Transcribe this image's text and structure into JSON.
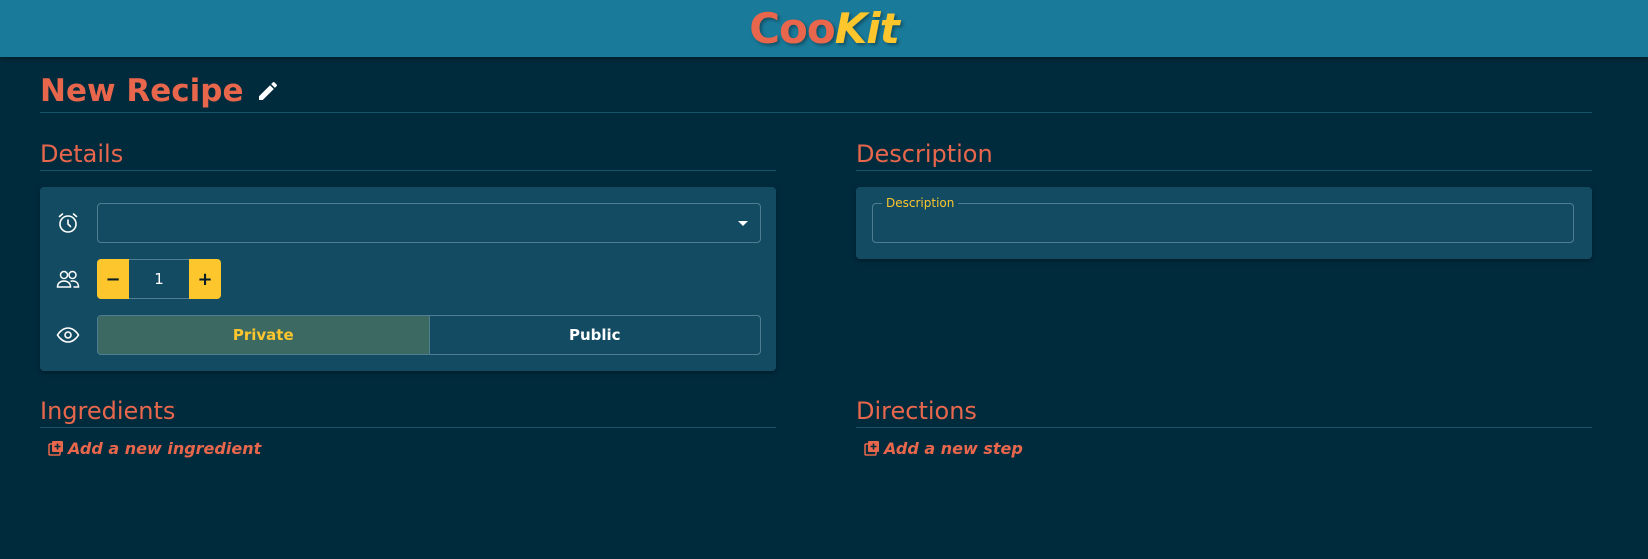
{
  "header": {
    "logo_part1": "Coo",
    "logo_part2": "Kit"
  },
  "page": {
    "title": "New Recipe"
  },
  "details": {
    "title": "Details",
    "time_select_value": "",
    "servings": {
      "minus_label": "−",
      "value": "1",
      "plus_label": "+"
    },
    "visibility": {
      "options": [
        "Private",
        "Public"
      ],
      "selected": "Private"
    }
  },
  "description": {
    "title": "Description",
    "field_label": "Description",
    "value": ""
  },
  "ingredients": {
    "title": "Ingredients",
    "add_label": "Add a new ingredient"
  },
  "directions": {
    "title": "Directions",
    "add_label": "Add a new step"
  },
  "colors": {
    "background": "#002b3d",
    "header": "#1a7a9a",
    "card": "#134b63",
    "accent_orange": "#e8674c",
    "accent_yellow": "#fcc62c",
    "toggle_active": "#3c6a62"
  },
  "icons": {
    "edit": "pencil-icon",
    "time": "alarm-clock-icon",
    "servings": "people-icon",
    "visibility": "eye-icon",
    "dropdown": "caret-down-icon",
    "add": "add-box-icon"
  }
}
